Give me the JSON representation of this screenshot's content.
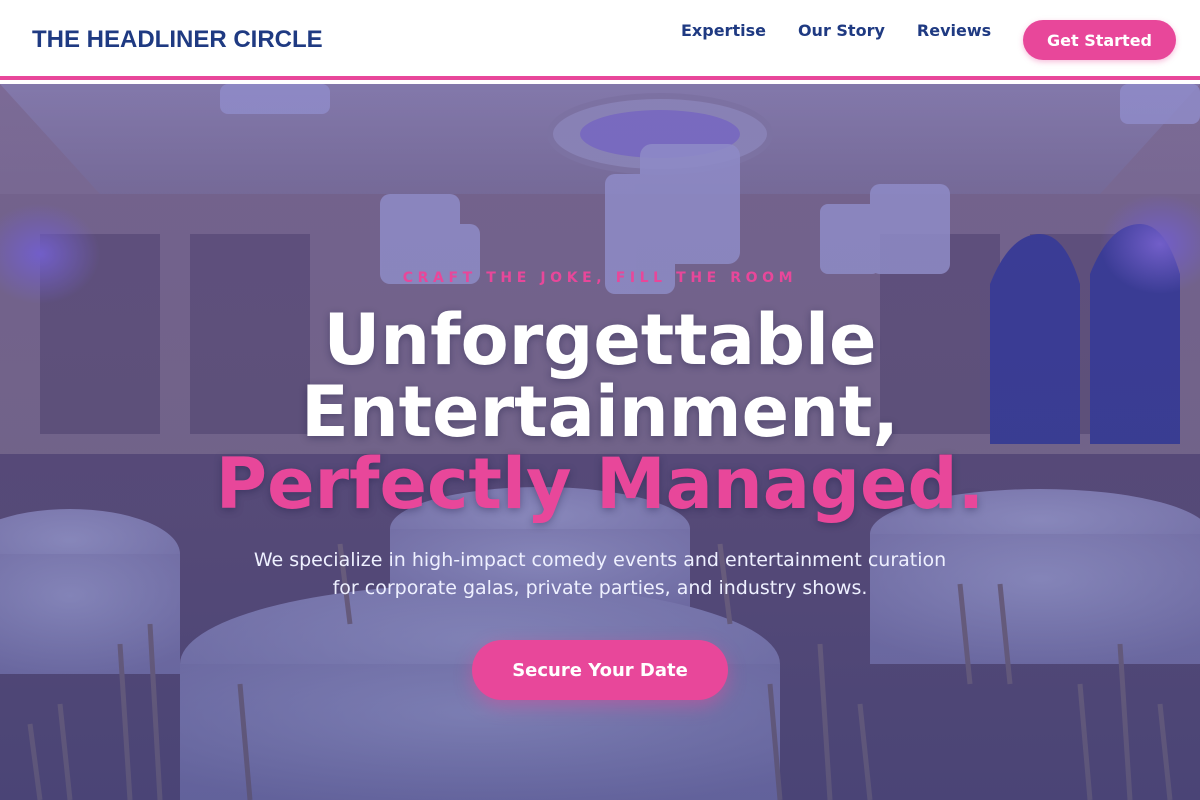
{
  "brand": {
    "name": "THE HEADLINER CIRCLE"
  },
  "nav": {
    "links": [
      {
        "label": "Expertise"
      },
      {
        "label": "Our Story"
      },
      {
        "label": "Reviews"
      }
    ],
    "cta_label": "Get Started"
  },
  "hero": {
    "eyebrow": "CRAFT THE JOKE, FILL THE ROOM",
    "headline_line1": "Unforgettable",
    "headline_line2": "Entertainment,",
    "headline_accent": "Perfectly Managed.",
    "subtext": "We specialize in high-impact comedy events and entertainment curation for corporate galas, private parties, and industry shows.",
    "cta_label": "Secure Your Date",
    "background_image": "ballroom-photo"
  },
  "colors": {
    "accent": "#e8479a",
    "brand": "#1f3a82",
    "overlay": "#3c37a0",
    "white": "#ffffff"
  }
}
